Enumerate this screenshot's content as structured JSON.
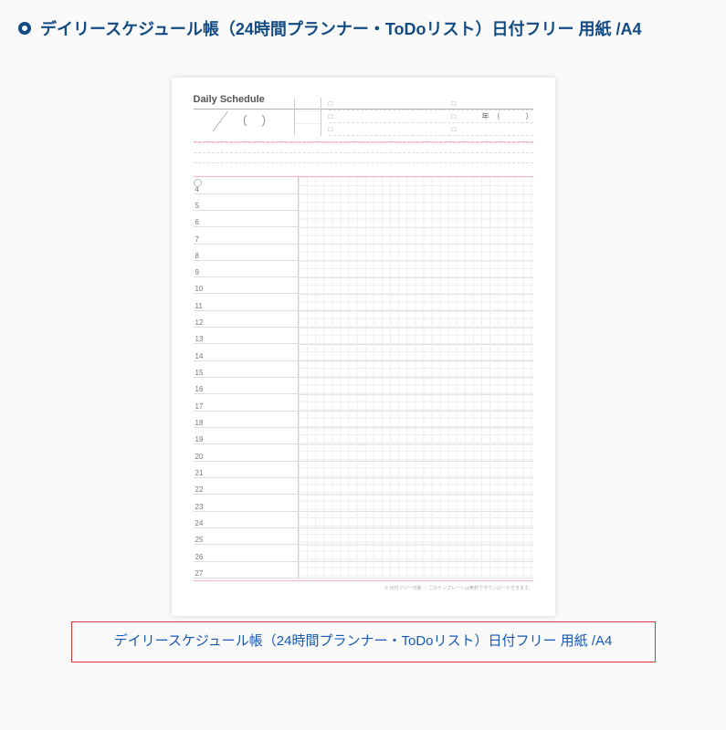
{
  "header": {
    "title": "デイリースケジュール帳（24時間プランナー・ToDoリスト）日付フリー 用紙 /A4"
  },
  "page": {
    "title": "Daily Schedule",
    "year_label": "年",
    "year_open": "（",
    "year_close": "）",
    "slash": "／",
    "paren": "（  ）",
    "checkbox_glyph": "□",
    "hours": [
      "4",
      "5",
      "6",
      "7",
      "8",
      "9",
      "10",
      "11",
      "12",
      "13",
      "14",
      "15",
      "16",
      "17",
      "18",
      "19",
      "20",
      "21",
      "22",
      "23",
      "24",
      "25",
      "26",
      "27"
    ],
    "footer_note": "© 日付フリー印刷 ｜ このテンプレートは無料でダウンロードできます。"
  },
  "caption": {
    "text": "デイリースケジュール帳（24時間プランナー・ToDoリスト）日付フリー 用紙 /A4"
  }
}
